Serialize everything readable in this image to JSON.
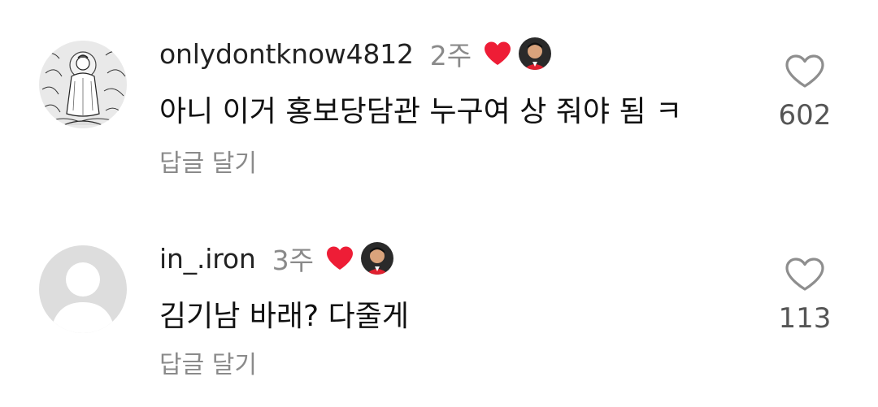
{
  "comments": [
    {
      "username": "onlydontknow4812",
      "time": "2주",
      "text": "아니 이거 홍보당담관 누구여 상 줘야 됨 ㅋ",
      "reply_label": "답글 달기",
      "likes": "602",
      "avatar_icon": "buddha-illustration-avatar",
      "liked_by_creator": true
    },
    {
      "username": "in_.iron",
      "time": "3주",
      "text": "김기남 바래? 다줄게",
      "reply_label": "답글 달기",
      "likes": "113",
      "avatar_icon": "default-profile-avatar",
      "liked_by_creator": true
    }
  ],
  "colors": {
    "heart_red": "#ee1d36",
    "secondary_text": "#8a8a8a",
    "like_outline": "#8e8e8e"
  }
}
